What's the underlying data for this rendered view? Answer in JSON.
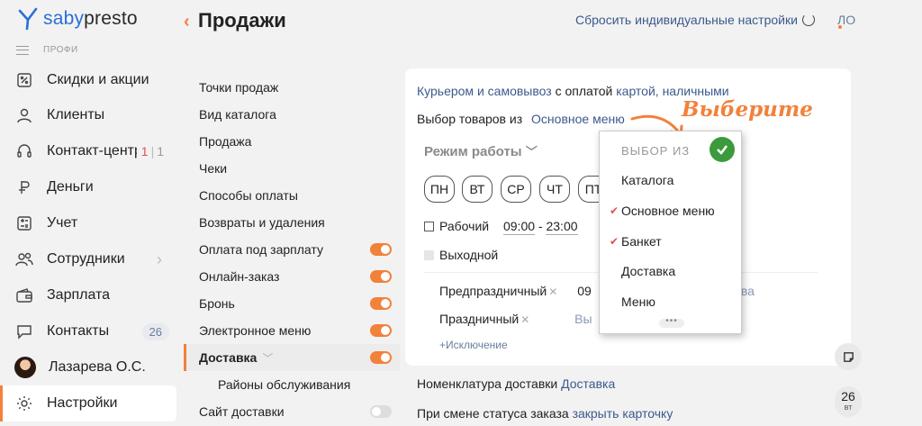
{
  "app": {
    "logo_left": "saby",
    "logo_right": "presto",
    "plan_label": "ПРОФИ"
  },
  "sidebar": {
    "items": [
      {
        "label": "Скидки и акции",
        "icon": "percent-icon"
      },
      {
        "label": "Клиенты",
        "icon": "client-icon"
      },
      {
        "label": "Контакт-центр",
        "icon": "headset-icon",
        "counter_red": "1",
        "counter": "1"
      },
      {
        "label": "Деньги",
        "icon": "money-icon"
      },
      {
        "label": "Учет",
        "icon": "accounting-icon"
      },
      {
        "label": "Сотрудники",
        "icon": "employees-icon",
        "chevron": "›"
      },
      {
        "label": "Зарплата",
        "icon": "wallet-icon"
      },
      {
        "label": "Контакты",
        "icon": "contacts-icon",
        "badge": "26"
      },
      {
        "label": "Лазарева О.С.",
        "icon": "avatar"
      },
      {
        "label": "Настройки",
        "icon": "settings-icon"
      }
    ]
  },
  "header": {
    "back": "‹",
    "title": "Продажи",
    "reset": "Сбросить индивидуальные настройки",
    "initials": "ЛО"
  },
  "settings": {
    "items": [
      {
        "label": "Точки продаж"
      },
      {
        "label": "Вид каталога"
      },
      {
        "label": "Продажа"
      },
      {
        "label": "Чеки"
      },
      {
        "label": "Способы оплаты"
      },
      {
        "label": "Возвраты и удаления"
      },
      {
        "label": "Оплата под зарплату",
        "toggle": true
      },
      {
        "label": "Онлайн-заказ",
        "toggle": true
      },
      {
        "label": "Бронь",
        "toggle": true
      },
      {
        "label": "Электронное меню",
        "toggle": true
      },
      {
        "label": "Доставка",
        "toggle": true,
        "active": true
      },
      {
        "label": "Районы обслуживания",
        "sub": true
      },
      {
        "label": "Сайт доставки",
        "toggle": false
      }
    ]
  },
  "panel": {
    "delivery_type": "Курьером и самовывоз",
    "payment_prefix": "с оплатой",
    "payment_methods": "картой, наличными",
    "selection_label": "Выбор товаров из",
    "selection_value": "Основное меню",
    "mode_label": "Режим работы",
    "days": [
      "ПН",
      "ВТ",
      "СР",
      "ЧТ",
      "ПТ"
    ],
    "workday_label": "Рабочий",
    "time_from": "09:00",
    "time_sep": "-",
    "time_to": "23:00",
    "dayoff_label": "Выходной",
    "preholiday_label": "Предпраздничный",
    "preholiday_time": "09",
    "preholiday_right": "рыва",
    "holiday_label": "Праздничный",
    "holiday_value": "Вы",
    "add_exception": "+Исключение",
    "nomenclature_label": "Номенклатура доставки",
    "nomenclature_value": "Доставка",
    "status_label": "При смене статуса заказа",
    "status_value": "закрыть карточку"
  },
  "popup": {
    "title": "ВЫБОР ИЗ",
    "items": [
      {
        "label": "Каталога",
        "checked": false
      },
      {
        "label": "Основное меню",
        "checked": true
      },
      {
        "label": "Банкет",
        "checked": true
      },
      {
        "label": "Доставка",
        "checked": false
      },
      {
        "label": "Меню",
        "checked": false
      }
    ],
    "more": "•••"
  },
  "annotation": {
    "text": "Выберите"
  },
  "widgets": {
    "date_num": "26",
    "date_day": "вт"
  },
  "colors": {
    "accent": "#f2813a",
    "link": "#3b5a8c",
    "ok": "#3c9a3c"
  }
}
